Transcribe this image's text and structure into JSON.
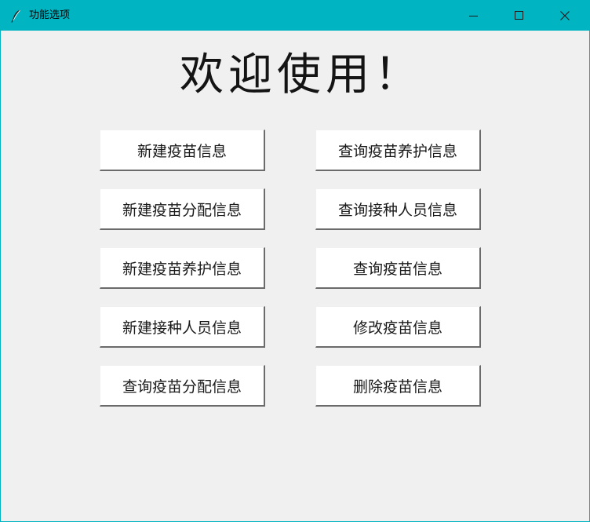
{
  "window": {
    "title": "功能选项",
    "icons": {
      "app": "feather-icon",
      "minimize": "minimize-icon",
      "maximize": "maximize-icon",
      "close": "close-icon"
    },
    "accent_color": "#00b4c2"
  },
  "main": {
    "heading": "欢迎使用！",
    "buttons": {
      "new_vaccine_info": "新建疫苗信息",
      "query_vaccine_care_info": "查询疫苗养护信息",
      "new_vaccine_distribution_info": "新建疫苗分配信息",
      "query_vaccinator_info": "查询接种人员信息",
      "new_vaccine_care_info": "新建疫苗养护信息",
      "query_vaccine_info": "查询疫苗信息",
      "new_vaccinator_info": "新建接种人员信息",
      "modify_vaccine_info": "修改疫苗信息",
      "query_vaccine_distribution_info": "查询疫苗分配信息",
      "delete_vaccine_info": "删除疫苗信息"
    }
  }
}
